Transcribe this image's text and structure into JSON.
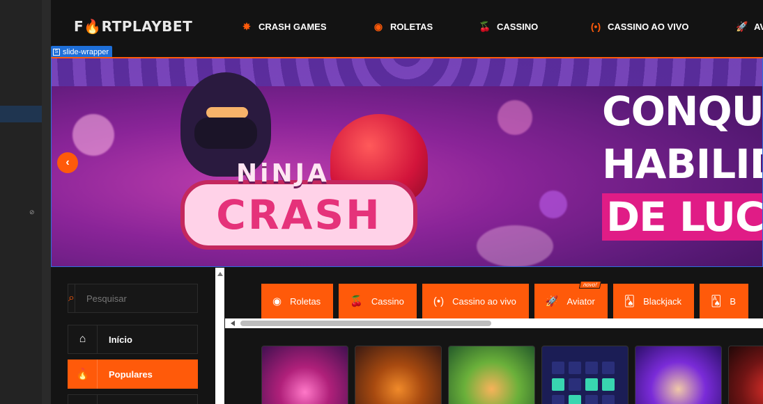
{
  "brand": {
    "logo_prefix": "F",
    "logo_highlight": "🔥",
    "logo_text": "RTPLAYBET",
    "accent": "#ff5a0a"
  },
  "nav": [
    {
      "icon": "starburst-icon",
      "label": "CRASH GAMES"
    },
    {
      "icon": "roulette-icon",
      "label": "ROLETAS"
    },
    {
      "icon": "cherries-icon",
      "label": "CASSINO"
    },
    {
      "icon": "live-broadcast-icon",
      "label": "CASSINO AO VIVO"
    },
    {
      "icon": "rocket-icon",
      "label": "AV"
    }
  ],
  "devtools": {
    "slide_tag": "slide-wrapper"
  },
  "banner": {
    "game_title_top": "NiNJA",
    "game_title_bottom": "CRASH",
    "headline_1": "CONQUIST",
    "headline_2": "HABILIDAI",
    "headline_3": "DE LUCRA"
  },
  "search": {
    "placeholder": "Pesquisar"
  },
  "sidebar": {
    "items": [
      {
        "icon": "home-icon",
        "label": "Início",
        "active": false
      },
      {
        "icon": "fire-icon",
        "label": "Populares",
        "active": true
      }
    ]
  },
  "categories": [
    {
      "icon": "roulette-icon",
      "label": "Roletas"
    },
    {
      "icon": "cherries-icon",
      "label": "Cassino"
    },
    {
      "icon": "live-broadcast-icon",
      "label": "Cassino ao vivo"
    },
    {
      "icon": "rocket-icon",
      "label": "Aviator",
      "badge": "novo!"
    },
    {
      "icon": "cards-icon",
      "label": "Blackjack"
    },
    {
      "icon": "cards-icon",
      "label": "B"
    }
  ]
}
